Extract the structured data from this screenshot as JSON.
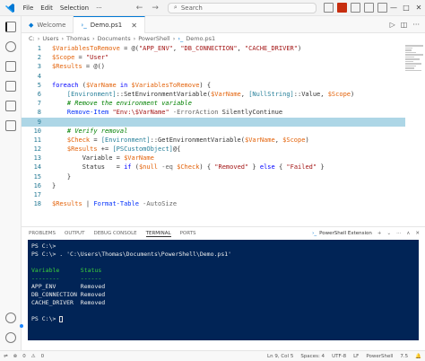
{
  "menu": {
    "file": "File",
    "edit": "Edit",
    "selection": "Selection"
  },
  "search": {
    "text": "Search"
  },
  "tabs": [
    {
      "label": "Welcome"
    },
    {
      "label": "Demo.ps1"
    }
  ],
  "breadcrumb": [
    "C:",
    "Users",
    "Thomas",
    "Documents",
    "PowerShell",
    "Demo.ps1"
  ],
  "editor": {
    "highlighted_line": 9,
    "lines": [
      "$VariablesToRemove = @(\"APP_ENV\", \"DB_CONNECTION\", \"CACHE_DRIVER\")",
      "$Scope = \"User\"",
      "$Results = @()",
      "",
      "foreach ($VarName in $VariablesToRemove) {",
      "    [Environment]::SetEnvironmentVariable($VarName, [NullString]::Value, $Scope)",
      "    # Remove the environment variable",
      "    Remove-Item \"Env:\\$VarName\" -ErrorAction SilentlyContinue",
      "",
      "    # Verify removal",
      "    $Check = [Environment]::GetEnvironmentVariable($VarName, $Scope)",
      "    $Results += [PSCustomObject]@{",
      "        Variable = $VarName",
      "        Status   = if ($null -eq $Check) { \"Removed\" } else { \"Failed\" }",
      "    }",
      "}",
      "",
      "$Results | Format-Table -AutoSize"
    ]
  },
  "panel": {
    "tabs": [
      "PROBLEMS",
      "OUTPUT",
      "DEBUG CONSOLE",
      "TERMINAL",
      "PORTS"
    ],
    "active_tab": "TERMINAL",
    "terminal_name": "PowerShell Extension"
  },
  "terminal": {
    "lines": [
      "PS C:\\> ",
      "PS C:\\> . 'C:\\Users\\Thomas\\Documents\\PowerShell\\Demo.ps1'",
      "",
      "Variable      Status",
      "--------      ------",
      "APP_ENV       Removed",
      "DB_CONNECTION Removed",
      "CACHE_DRIVER  Removed",
      "",
      "PS C:\\> "
    ]
  },
  "status": {
    "errors": "0",
    "warnings": "0",
    "position": "Ln 9, Col 5",
    "spaces": "Spaces: 4",
    "encoding": "UTF-8",
    "eol": "LF",
    "language": "PowerShell",
    "version": "7.5"
  },
  "colors": {
    "accent": "#0078d4",
    "terminal_bg": "#012456",
    "header_green": "#3bd03b"
  }
}
